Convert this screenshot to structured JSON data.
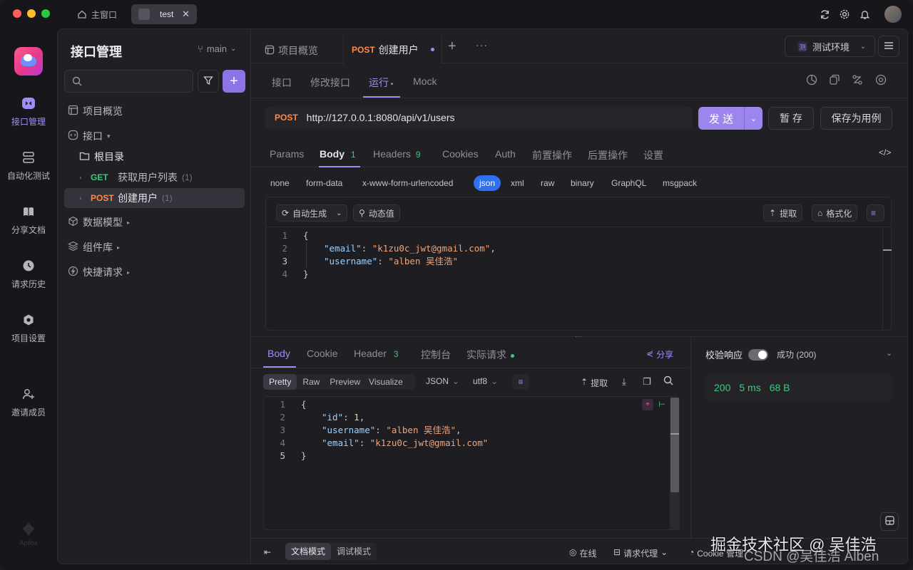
{
  "window": {
    "tabs": [
      {
        "label": "主窗口",
        "icon": "home-icon"
      },
      {
        "label": "test",
        "icon": "project-icon"
      }
    ]
  },
  "rail": {
    "items": [
      {
        "label": "接口管理",
        "icon": "api-icon"
      },
      {
        "label": "自动化测试",
        "icon": "automation-icon"
      },
      {
        "label": "分享文档",
        "icon": "book-icon"
      },
      {
        "label": "请求历史",
        "icon": "history-icon"
      },
      {
        "label": "项目设置",
        "icon": "settings-icon"
      },
      {
        "label": "邀请成员",
        "icon": "add-user-icon"
      }
    ],
    "brand_text": "Apifox"
  },
  "tree": {
    "title": "接口管理",
    "branch": "main",
    "search_placeholder": "",
    "items": {
      "overview": "项目概览",
      "apis": "接口",
      "root": "根目录",
      "get_method": "GET",
      "get_name": "获取用户列表",
      "get_count": "(1)",
      "post_method": "POST",
      "post_name": "创建用户",
      "post_count": "(1)",
      "models": "数据模型",
      "components": "组件库",
      "quick": "快捷请求"
    }
  },
  "doc_tabs": {
    "overview": "项目概览",
    "active_method": "POST",
    "active_name": "创建用户",
    "env": "测试环境",
    "env_badge": "测"
  },
  "api_tabs": [
    "接口",
    "修改接口",
    "运行",
    "Mock"
  ],
  "request": {
    "method": "POST",
    "url": "http://127.0.0.1:8080/api/v1/users",
    "send": "发 送",
    "save_temp": "暂 存",
    "save_case": "保存为用例"
  },
  "param_tabs": {
    "params": "Params",
    "body": "Body",
    "body_count": "1",
    "headers": "Headers",
    "headers_count": "9",
    "cookies": "Cookies",
    "auth": "Auth",
    "pre": "前置操作",
    "post": "后置操作",
    "settings": "设置"
  },
  "body_types": [
    "none",
    "form-data",
    "x-www-form-urlencoded",
    "json",
    "xml",
    "raw",
    "binary",
    "GraphQL",
    "msgpack"
  ],
  "body_tools": {
    "auto": "自动生成",
    "dynamic": "动态值",
    "extract": "提取",
    "format": "格式化"
  },
  "request_body": {
    "lines": [
      "1",
      "2",
      "3",
      "4"
    ],
    "open": "{",
    "close": "}",
    "email_key": "\"email\"",
    "email_val": "\"k1zu0c_jwt@gmail.com\"",
    "username_key": "\"username\"",
    "username_val": "\"alben 吴佳浩\""
  },
  "response_tabs": {
    "body": "Body",
    "cookie": "Cookie",
    "header": "Header",
    "header_count": "3",
    "console": "控制台",
    "actual": "实际请求",
    "share": "分享"
  },
  "response_view": {
    "modes": [
      "Pretty",
      "Raw",
      "Preview",
      "Visualize"
    ],
    "format": "JSON",
    "encoding": "utf8",
    "extract": "提取"
  },
  "response_body": {
    "lines": [
      "1",
      "2",
      "3",
      "4",
      "5"
    ],
    "open": "{",
    "close": "}",
    "id_key": "\"id\"",
    "id_val": "1",
    "username_key": "\"username\"",
    "username_val": "\"alben 吴佳浩\"",
    "email_key": "\"email\"",
    "email_val": "\"k1zu0c_jwt@gmail.com\""
  },
  "validate": {
    "label": "校验响应",
    "result": "成功 (200)",
    "status": "200",
    "time": "5 ms",
    "size": "68 B"
  },
  "footer": {
    "doc_mode": "文档模式",
    "debug_mode": "调试模式",
    "online": "在线",
    "proxy": "请求代理",
    "cookie": "Cookie 管理"
  },
  "watermark": "掘金技术社区 @ 吴佳浩",
  "watermark2": "CSDN @吴佳浩 Alben",
  "colors": {
    "accent": "#a08cf5",
    "get": "#3ec97e",
    "post": "#ff8a4c",
    "json_chip": "#2f6ff0"
  }
}
